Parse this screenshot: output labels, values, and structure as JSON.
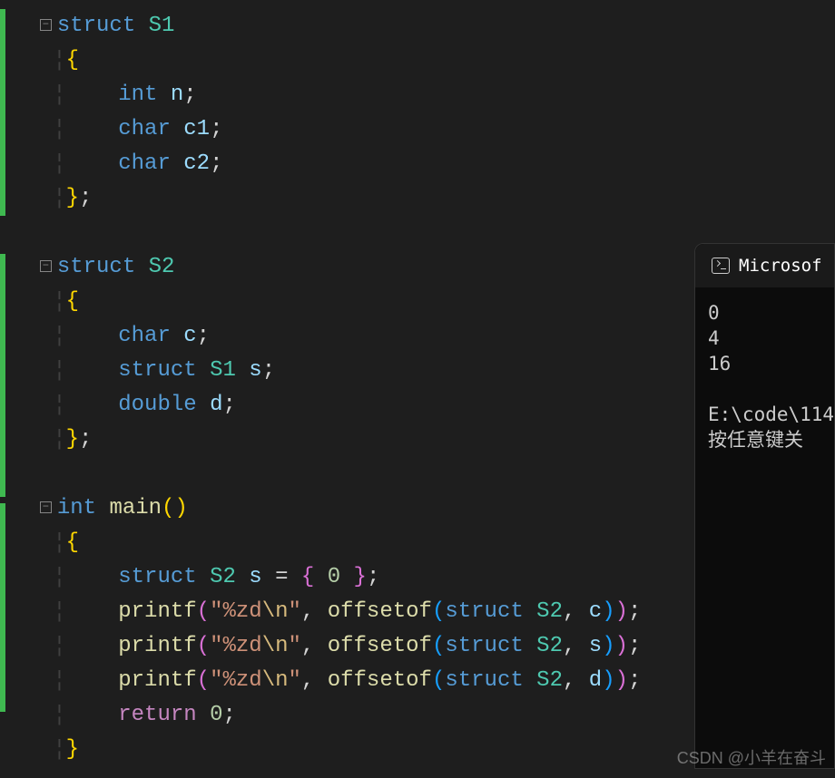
{
  "code": {
    "struct1": {
      "keyword": "struct",
      "name": "S1",
      "open": "{",
      "field1_type": "int",
      "field1_name": "n",
      "field2_type": "char",
      "field2_name": "c1",
      "field3_type": "char",
      "field3_name": "c2",
      "close": "}",
      "semi": ";"
    },
    "struct2": {
      "keyword": "struct",
      "name": "S2",
      "open": "{",
      "field1_type": "char",
      "field1_name": "c",
      "field2_kw": "struct",
      "field2_type": "S1",
      "field2_name": "s",
      "field3_type": "double",
      "field3_name": "d",
      "close": "}",
      "semi": ";"
    },
    "main": {
      "rettype": "int",
      "name": "main",
      "open": "{",
      "decl_kw": "struct",
      "decl_type": "S2",
      "decl_name": "s",
      "eq": "=",
      "init_open": "{",
      "init_val": "0",
      "init_close": "}",
      "printf": "printf",
      "fmt_open": "\"",
      "fmt": "%zd",
      "esc": "\\n",
      "fmt_close": "\"",
      "offsetof": "offsetof",
      "arg_kw": "struct",
      "arg_type": "S2",
      "arg1": "c",
      "arg2": "s",
      "arg3": "d",
      "return_kw": "return",
      "return_val": "0",
      "close": "}"
    }
  },
  "console": {
    "title": "Microsof",
    "line1": "0",
    "line2": "4",
    "line3": "16",
    "path": "E:\\code\\114",
    "prompt": "按任意键关"
  },
  "watermark": "CSDN @小羊在奋斗",
  "fold": "−"
}
